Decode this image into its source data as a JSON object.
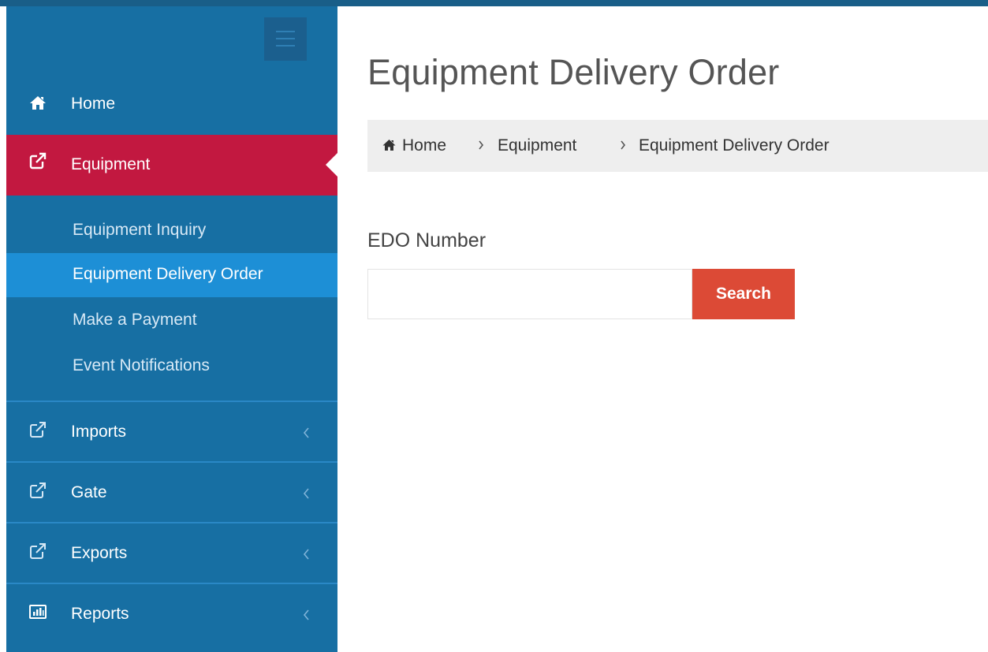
{
  "sidebar": {
    "items": [
      {
        "label": "Home",
        "icon": "home-icon"
      },
      {
        "label": "Equipment",
        "icon": "external-link-icon",
        "active": true,
        "children": [
          {
            "label": "Equipment Inquiry"
          },
          {
            "label": "Equipment Delivery Order",
            "active": true
          },
          {
            "label": "Make a Payment"
          },
          {
            "label": "Event Notifications"
          }
        ]
      },
      {
        "label": "Imports",
        "icon": "external-link-icon"
      },
      {
        "label": "Gate",
        "icon": "external-link-icon"
      },
      {
        "label": "Exports",
        "icon": "external-link-icon"
      },
      {
        "label": "Reports",
        "icon": "bar-chart-icon"
      }
    ]
  },
  "header": {
    "title": "Equipment Delivery Order"
  },
  "breadcrumb": {
    "items": [
      "Home",
      "Equipment",
      "Equipment Delivery Order"
    ]
  },
  "form": {
    "edo_label": "EDO Number",
    "edo_value": "",
    "edo_placeholder": "",
    "search_label": "Search"
  },
  "colors": {
    "sidebar_bg": "#176fa3",
    "active_item": "#c21840",
    "active_subitem": "#1d8fd6",
    "search_button": "#dc4a36",
    "breadcrumb_bg": "#eeeeee"
  }
}
